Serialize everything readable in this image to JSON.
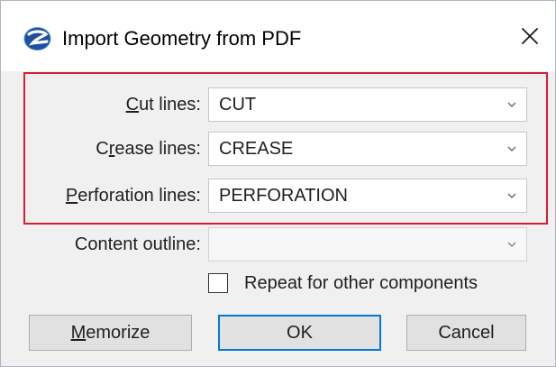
{
  "window": {
    "title": "Import Geometry from PDF",
    "close_glyph": "✕"
  },
  "fields": {
    "cut": {
      "label_pre": "",
      "label_key": "C",
      "label_post": "ut lines:",
      "value": "CUT"
    },
    "crease": {
      "label_pre": "C",
      "label_key": "r",
      "label_post": "ease lines:",
      "value": "CREASE"
    },
    "perforation": {
      "label_pre": "",
      "label_key": "P",
      "label_post": "erforation lines:",
      "value": "PERFORATION"
    },
    "content_outline": {
      "label": "Content outline:",
      "value": ""
    }
  },
  "repeat": {
    "label": "Repeat for other components",
    "checked": false
  },
  "buttons": {
    "memorize": {
      "key": "M",
      "rest": "emorize"
    },
    "ok": "OK",
    "cancel": "Cancel"
  },
  "colors": {
    "highlight": "#d21f32",
    "default_button_border": "#0078d7",
    "icon": "#1e4fa3"
  },
  "icons": {
    "app": "app-logo-icon",
    "close": "close-icon",
    "dropdown": "chevron-down-icon"
  }
}
